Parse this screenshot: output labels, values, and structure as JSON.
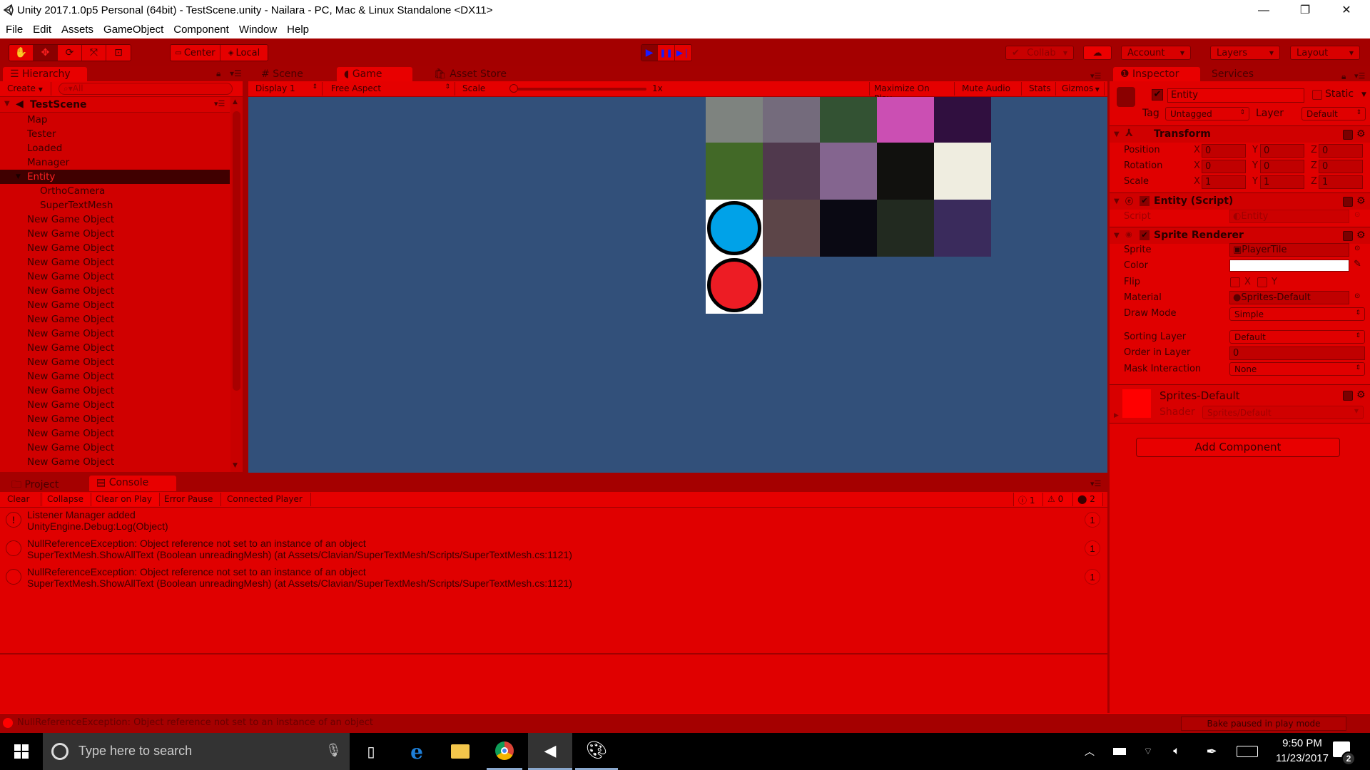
{
  "window": {
    "title": "Unity 2017.1.0p5 Personal (64bit) - TestScene.unity - Nailara - PC, Mac & Linux Standalone <DX11>",
    "minimize": "—",
    "maximize": "❐",
    "close": "✕"
  },
  "menu": [
    "File",
    "Edit",
    "Assets",
    "GameObject",
    "Component",
    "Window",
    "Help"
  ],
  "toolbar": {
    "tools": [
      {
        "name": "hand-tool",
        "glyph": "✋"
      },
      {
        "name": "move-tool",
        "glyph": "✥"
      },
      {
        "name": "rotate-tool",
        "glyph": "⟳"
      },
      {
        "name": "scale-tool",
        "glyph": "⤧"
      },
      {
        "name": "rect-tool",
        "glyph": "⊡"
      }
    ],
    "active_tool": "move-tool",
    "pivot": "Center",
    "space": "Local",
    "play_glyph": "▶",
    "pause_glyph": "❚❚",
    "step_glyph": "▶❘",
    "play_color": "#1a1aff",
    "collab": "Collab",
    "cloud_glyph": "☁",
    "account": "Account",
    "layers": "Layers",
    "layout": "Layout"
  },
  "hierarchy": {
    "tab": "Hierarchy",
    "create": "Create",
    "search_placeholder": "All",
    "scene": "TestScene",
    "items": [
      {
        "label": "Map",
        "indent": 1
      },
      {
        "label": "Tester",
        "indent": 1
      },
      {
        "label": "Loaded",
        "indent": 1
      },
      {
        "label": "Manager",
        "indent": 1
      },
      {
        "label": "Entity",
        "indent": 1,
        "selected": true,
        "expanded": true
      },
      {
        "label": "OrthoCamera",
        "indent": 2
      },
      {
        "label": "SuperTextMesh",
        "indent": 2
      },
      {
        "label": "New Game Object",
        "indent": 1
      },
      {
        "label": "New Game Object",
        "indent": 1
      },
      {
        "label": "New Game Object",
        "indent": 1
      },
      {
        "label": "New Game Object",
        "indent": 1
      },
      {
        "label": "New Game Object",
        "indent": 1
      },
      {
        "label": "New Game Object",
        "indent": 1
      },
      {
        "label": "New Game Object",
        "indent": 1
      },
      {
        "label": "New Game Object",
        "indent": 1
      },
      {
        "label": "New Game Object",
        "indent": 1
      },
      {
        "label": "New Game Object",
        "indent": 1
      },
      {
        "label": "New Game Object",
        "indent": 1
      },
      {
        "label": "New Game Object",
        "indent": 1
      },
      {
        "label": "New Game Object",
        "indent": 1
      },
      {
        "label": "New Game Object",
        "indent": 1
      },
      {
        "label": "New Game Object",
        "indent": 1
      },
      {
        "label": "New Game Object",
        "indent": 1
      },
      {
        "label": "New Game Object",
        "indent": 1
      },
      {
        "label": "New Game Object",
        "indent": 1
      }
    ]
  },
  "center_tabs": {
    "scene": "Scene",
    "game": "Game",
    "asset_store": "Asset Store"
  },
  "game_bar": {
    "display": "Display 1",
    "aspect": "Free Aspect",
    "scale_label": "Scale",
    "scale_value": "1x",
    "scale_fraction": 0.0,
    "maximize_on_play": "Maximize On Play",
    "mute_audio": "Mute Audio",
    "stats": "Stats",
    "gizmos": "Gizmos"
  },
  "game_view": {
    "background": "#32507a",
    "tiles": [
      [
        "#7e837f",
        "#746b7c",
        "#335233",
        "#cb4fb3",
        "#300f3f"
      ],
      [
        "#426927",
        "#50394d",
        "#84658f",
        "#11110e",
        "#efede0"
      ],
      [
        "player",
        "#5c4548",
        "#0a0913",
        "#222a20",
        "#3a2b5c"
      ]
    ],
    "player_colors": {
      "top": "#00a2e8",
      "bottom": "#ed1c24",
      "outline": "#000000",
      "backdrop": "#ffffff"
    }
  },
  "inspector": {
    "tab": "Inspector",
    "services_tab": "Services",
    "object_name": "Entity",
    "active": true,
    "static_label": "Static",
    "static": false,
    "tag_label": "Tag",
    "tag": "Untagged",
    "layer_label": "Layer",
    "layer": "Default",
    "transform": {
      "title": "Transform",
      "rows": [
        {
          "label": "Position",
          "x": "0",
          "y": "0",
          "z": "0"
        },
        {
          "label": "Rotation",
          "x": "0",
          "y": "0",
          "z": "0"
        },
        {
          "label": "Scale",
          "x": "1",
          "y": "1",
          "z": "1"
        }
      ]
    },
    "script": {
      "title": "Entity (Script)",
      "script_label": "Script",
      "script_value": "Entity"
    },
    "sprite_renderer": {
      "title": "Sprite Renderer",
      "sprite_label": "Sprite",
      "sprite": "PlayerTile",
      "color_label": "Color",
      "color": "#ffffff",
      "flip_label": "Flip",
      "flip_x": "X",
      "flip_y": "Y",
      "material_label": "Material",
      "material": "Sprites-Default",
      "draw_mode_label": "Draw Mode",
      "draw_mode": "Simple",
      "sorting_layer_label": "Sorting Layer",
      "sorting_layer": "Default",
      "order_label": "Order in Layer",
      "order": "0",
      "mask_label": "Mask Interaction",
      "mask": "None"
    },
    "material": {
      "name": "Sprites-Default",
      "shader_label": "Shader",
      "shader": "Sprites/Default"
    },
    "add_component": "Add Component"
  },
  "console": {
    "project_tab": "Project",
    "console_tab": "Console",
    "buttons": [
      "Clear",
      "Collapse",
      "Clear on Play",
      "Error Pause",
      "Connected Player"
    ],
    "counts": {
      "info": "1",
      "warning": "0",
      "error": "2"
    },
    "messages": [
      {
        "type": "info",
        "line1": "Listener Manager added",
        "line2": "UnityEngine.Debug:Log(Object)",
        "count": "1"
      },
      {
        "type": "error",
        "line1": "NullReferenceException: Object reference not set to an instance of an object",
        "line2": "SuperTextMesh.ShowAllText (Boolean unreadingMesh) (at Assets/Clavian/SuperTextMesh/Scripts/SuperTextMesh.cs:1121)",
        "count": "1"
      },
      {
        "type": "error",
        "line1": "NullReferenceException: Object reference not set to an instance of an object",
        "line2": "SuperTextMesh.ShowAllText (Boolean unreadingMesh) (at Assets/Clavian/SuperTextMesh/Scripts/SuperTextMesh.cs:1121)",
        "count": "1"
      }
    ]
  },
  "statusbar": {
    "message": "NullReferenceException: Object reference not set to an instance of an object",
    "bake": "Bake paused in play mode"
  },
  "taskbar": {
    "search_placeholder": "Type here to search",
    "time": "9:50 PM",
    "date": "11/23/2017",
    "notifications": "2"
  }
}
